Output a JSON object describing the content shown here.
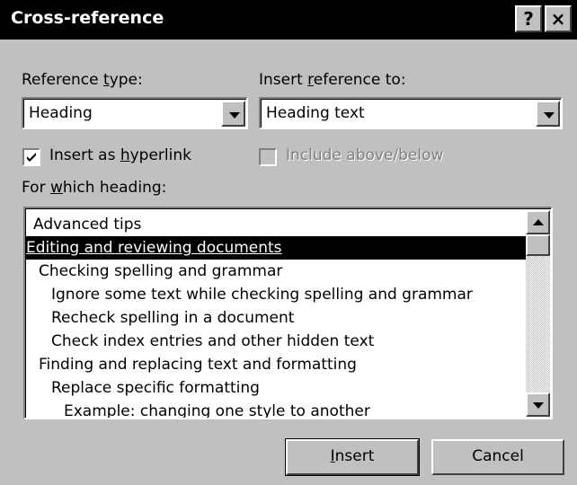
{
  "window": {
    "title": "Cross-reference",
    "help_glyph": "?",
    "close_glyph": "×"
  },
  "reference_type": {
    "label_pre": "Reference ",
    "label_key": "t",
    "label_post": "ype:",
    "value": "Heading"
  },
  "insert_reference_to": {
    "label_pre": "Insert ",
    "label_key": "r",
    "label_post": "eference to:",
    "value": "Heading text"
  },
  "insert_as_hyperlink": {
    "label_pre": "Insert as ",
    "label_key": "h",
    "label_post": "yperlink",
    "checked": true
  },
  "include_above_below": {
    "label": "Include above/below",
    "checked": false,
    "enabled": false
  },
  "for_which_heading": {
    "label_pre": "For ",
    "label_key": "w",
    "label_post": "hich heading:"
  },
  "headings": [
    {
      "text": "Advanced tips",
      "level": 1
    },
    {
      "text": "Editing and reviewing documents",
      "level": 0,
      "selected": true
    },
    {
      "text": "Checking spelling and grammar",
      "level": 1
    },
    {
      "text": "Ignore some text while checking spelling and grammar",
      "level": 2
    },
    {
      "text": "Recheck spelling in a document",
      "level": 2
    },
    {
      "text": "Check index entries and other hidden text",
      "level": 2
    },
    {
      "text": "Finding and replacing text and formatting",
      "level": 1
    },
    {
      "text": "Replace specific formatting",
      "level": 2
    },
    {
      "text": "Example: changing one style to another",
      "level": 3
    }
  ],
  "buttons": {
    "insert_key": "I",
    "insert_rest": "nsert",
    "cancel": "Cancel"
  }
}
